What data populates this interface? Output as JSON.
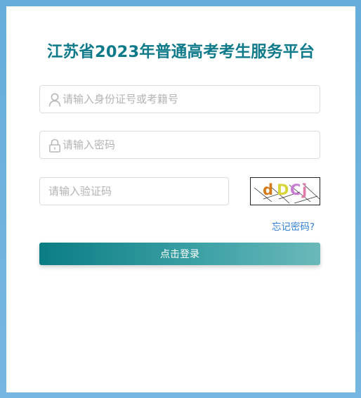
{
  "page": {
    "title": "江苏省2023年普通高考考生服务平台"
  },
  "form": {
    "username": {
      "placeholder": "请输入身份证号或考籍号",
      "value": "",
      "icon": "user-icon"
    },
    "password": {
      "placeholder": "请输入密码",
      "value": "",
      "icon": "lock-icon"
    },
    "captcha": {
      "placeholder": "请输入验证码",
      "value": "",
      "image_text": [
        "d",
        "D",
        "C",
        "j"
      ],
      "image_colors": [
        "#d47a1a",
        "#d6d63a",
        "#c77bd1",
        "#e07aa8"
      ]
    },
    "forgot_password_label": "忘记密码?",
    "login_label": "点击登录"
  },
  "colors": {
    "title": "#0f7a8a",
    "button_gradient_start": "#0a7d84",
    "button_gradient_end": "#6bb8ba",
    "link": "#2f7fd1",
    "background": "#6fb1de"
  }
}
